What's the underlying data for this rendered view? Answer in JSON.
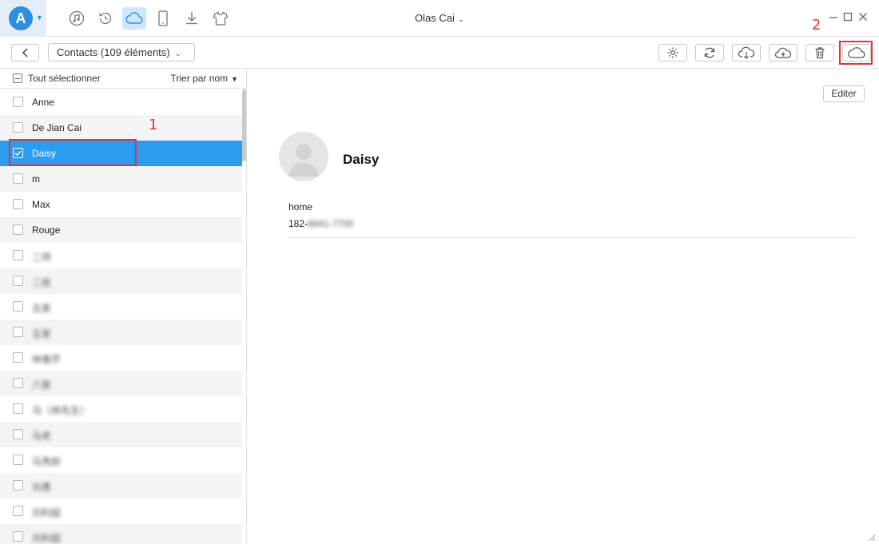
{
  "app": {
    "logo_letter": "A"
  },
  "nav_icons": [
    "music-icon",
    "history-icon",
    "cloud-icon",
    "phone-icon",
    "download-icon",
    "tshirt-icon"
  ],
  "device": {
    "name": "Olas Cai"
  },
  "toolbar": {
    "category_label": "Contacts (109 éléments)",
    "actions": [
      "settings-icon",
      "refresh-icon",
      "cloud-download-icon",
      "cloud-add-icon",
      "trash-icon",
      "cloud-icon"
    ]
  },
  "list": {
    "select_all_label": "Tout sélectionner",
    "sort_label": "Trier par nom",
    "contacts": [
      {
        "name": "Anne",
        "selected": false,
        "blurred": false
      },
      {
        "name": "De Jian Cai",
        "selected": false,
        "blurred": false
      },
      {
        "name": "Daisy",
        "selected": true,
        "blurred": false
      },
      {
        "name": "m",
        "selected": false,
        "blurred": false
      },
      {
        "name": "Max",
        "selected": false,
        "blurred": false
      },
      {
        "name": "Rouge",
        "selected": false,
        "blurred": false
      },
      {
        "name": "二帅",
        "selected": false,
        "blurred": true
      },
      {
        "name": "二玫",
        "selected": false,
        "blurred": true
      },
      {
        "name": "五家",
        "selected": false,
        "blurred": true
      },
      {
        "name": "五家",
        "selected": false,
        "blurred": true
      },
      {
        "name": "林春芹",
        "selected": false,
        "blurred": true
      },
      {
        "name": "六家",
        "selected": false,
        "blurred": true
      },
      {
        "name": "马（林先生）",
        "selected": false,
        "blurred": true
      },
      {
        "name": "马老",
        "selected": false,
        "blurred": true
      },
      {
        "name": "马秀龄",
        "selected": false,
        "blurred": true
      },
      {
        "name": "刘勇",
        "selected": false,
        "blurred": true
      },
      {
        "name": "刘利超",
        "selected": false,
        "blurred": true
      },
      {
        "name": "刘利超",
        "selected": false,
        "blurred": true
      }
    ]
  },
  "detail": {
    "edit_label": "Editer",
    "name": "Daisy",
    "field_label": "home",
    "field_value_prefix": "182-",
    "field_value_hidden": "8841-7700"
  },
  "annotations": {
    "step1": "1",
    "step2": "2",
    "color": "#e03333"
  },
  "colors": {
    "accent": "#2d9bef",
    "selected_row": "#2d9bef",
    "alt_row": "#f4f4f4"
  }
}
